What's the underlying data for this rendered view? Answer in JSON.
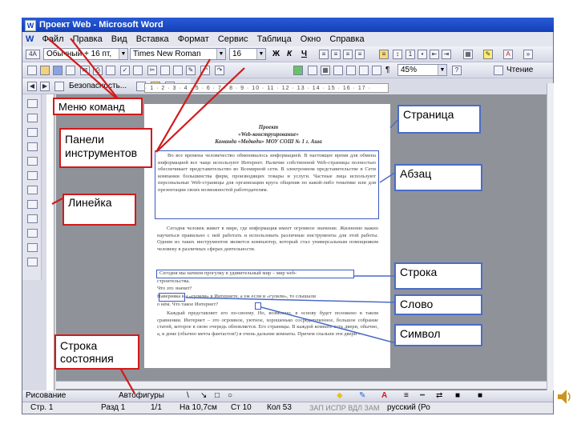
{
  "window": {
    "title": "Проект Web - Microsoft Word",
    "app_icon": "W"
  },
  "menu": {
    "logo": "W",
    "items": [
      "Файл",
      "Правка",
      "Вид",
      "Вставка",
      "Формат",
      "Сервис",
      "Таблица",
      "Окно",
      "Справка"
    ]
  },
  "format_toolbar": {
    "style": "Обычный + 16 пт,",
    "font": "Times New Roman",
    "size": "16",
    "bold": "Ж",
    "italic": "К",
    "underline": "Ч",
    "style_icon": "4A"
  },
  "standard_toolbar": {
    "zoom": "45%",
    "read_label": "Чтение",
    "pilcrow": "¶"
  },
  "web_toolbar": {
    "security_label": "Безопасность..."
  },
  "ruler": {
    "ticks": "· 1 · 2 · 3 · 4 · 5 · 6 · 7 · 8 · 9 · 10 · 11 · 12 · 13 · 14 · 15 · 16 · 17 ·"
  },
  "document": {
    "title_line1": "Проект",
    "title_line2": "«Web-конструирование»",
    "title_line3": "Команда «Медведи» МОУ СОШ № 1 г. Аша",
    "para1": "Во все времена человечество обменивалось информацией. В настоящее время для обмена информацией все чаще используют Интернет. Наличие собственной Web-страницы полностью обеспечивает представительство во Всемирной сети. В электронном представительстве в Сети компании большинства фирм, производящих товары и услуги. Частные лица используют персональные Web-страницы для организации круга общения по какой-либо тематике или для презентации своих возможностей работодателям.",
    "para2": "Сегодня человек живет в мире, где информация имеет огромное значение. Жизненно важно научиться правильно с ней работать и использовать различные инструменты для этой работы. Одним из таких инструментов является компьютер, который стал универсальным помощником человеку в различных сферах деятельности.",
    "line_highlight": "Сегодня мы начнем прогулку в удивительный мир – мир web-",
    "line_cont": "строительства.",
    "q1": "Что это значит?",
    "line3": "Наверняка вы «гуляли» в Интернете, а уж если и «гуляли», то слышали",
    "line4": "о нём. Что такое Интернет?",
    "para3": "Каждый представляет его по-своему. Но, возможно, в основу будет положено в таком сравнении. Интернет – это огромное, уютное, хорошенько сосредоточенное, большое собрание статей, которое в свою очередь обновляется. Его страницы. В каждой комнате есть двери, обычно, а, в доме (обычно мечта фантастов!) в очень дальние комнаты. Причем спальни эти двери –"
  },
  "callouts": {
    "menu": "Меню команд",
    "toolbars": "Панели инструментов",
    "ruler": "Линейка",
    "status": "Строка состояния",
    "page": "Страница",
    "paragraph": "Абзац",
    "line": "Строка",
    "word": "Слово",
    "symbol": "Символ"
  },
  "draw_toolbar": {
    "draw": "Рисование",
    "autoshapes": "Автофигуры"
  },
  "status": {
    "page": "Стр. 1",
    "section": "Разд 1",
    "pages": "1/1",
    "at": "На 10,7см",
    "line": "Ст 10",
    "col": "Кол 53",
    "flags": "ЗАП ИСПР ВДЛ ЗАМ",
    "lang": "русский (Ро"
  },
  "colors": {
    "title_blue": "#1340b8",
    "callout_red": "#d21a1a",
    "callout_blue": "#4b6cc7"
  }
}
